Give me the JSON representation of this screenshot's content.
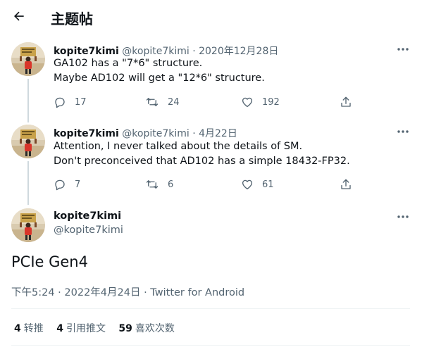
{
  "header": {
    "title": "主题帖"
  },
  "tweets": [
    {
      "name": "kopite7kimi",
      "handle": "@kopite7kimi",
      "date": "2020年12月28日",
      "lines": [
        "GA102 has a \"7*6\" structure.",
        "Maybe AD102 will get a \"12*6\" structure."
      ],
      "replies": "17",
      "retweets": "24",
      "likes": "192"
    },
    {
      "name": "kopite7kimi",
      "handle": "@kopite7kimi",
      "date": "4月22日",
      "lines": [
        "Attention, I never talked about the details of SM.",
        "Don't preconceived that AD102 has a simple 18432-FP32."
      ],
      "replies": "7",
      "retweets": "6",
      "likes": "61"
    }
  ],
  "focus": {
    "name": "kopite7kimi",
    "handle": "@kopite7kimi",
    "text": "PCIe Gen4",
    "time": "下午5:24",
    "date": "2022年4月24日",
    "source": "Twitter for Android",
    "retweets_count": "4",
    "retweets_label": "转推",
    "quotes_count": "4",
    "quotes_label": "引用推文",
    "likes_count": "59",
    "likes_label": "喜欢次数"
  },
  "separator": "·",
  "icons": [
    "back-arrow-icon",
    "more-icon",
    "reply-icon",
    "retweet-icon",
    "like-icon",
    "share-icon",
    "avatar"
  ],
  "colors": {
    "text": "#0f1419",
    "secondary": "#536471",
    "thread_line": "#cfd9de",
    "divider": "#eff3f4"
  }
}
